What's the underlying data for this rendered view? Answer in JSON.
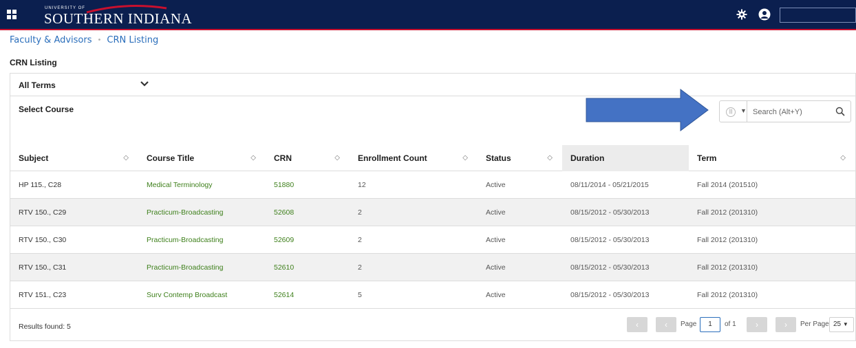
{
  "header": {
    "logo_small": "UNIVERSITY OF",
    "logo_name": "SOUTHERN INDIANA"
  },
  "breadcrumb": {
    "items": [
      "Faculty & Advisors",
      "CRN Listing"
    ],
    "separator": "•"
  },
  "section_title": "CRN Listing",
  "filters": {
    "term_label": "All Terms",
    "select_course_label": "Select Course",
    "search_placeholder": "Search (Alt+Y)"
  },
  "table": {
    "columns": [
      "Subject",
      "Course Title",
      "CRN",
      "Enrollment Count",
      "Status",
      "Duration",
      "Term"
    ],
    "rows": [
      [
        "HP 115., C28",
        "Medical Terminology",
        "51880",
        "12",
        "Active",
        "08/11/2014 - 05/21/2015",
        "Fall 2014 (201510)"
      ],
      [
        "RTV 150., C29",
        "Practicum-Broadcasting",
        "52608",
        "2",
        "Active",
        "08/15/2012 - 05/30/2013",
        "Fall 2012 (201310)"
      ],
      [
        "RTV 150., C30",
        "Practicum-Broadcasting",
        "52609",
        "2",
        "Active",
        "08/15/2012 - 05/30/2013",
        "Fall 2012 (201310)"
      ],
      [
        "RTV 150., C31",
        "Practicum-Broadcasting",
        "52610",
        "2",
        "Active",
        "08/15/2012 - 05/30/2013",
        "Fall 2012 (201310)"
      ],
      [
        "RTV 151., C23",
        "Surv Contemp Broadcast",
        "52614",
        "5",
        "Active",
        "08/15/2012 - 05/30/2013",
        "Fall 2012 (201310)"
      ]
    ]
  },
  "footer": {
    "results": "Results found: 5",
    "page_label": "Page",
    "page_value": "1",
    "of_label": "of 1",
    "per_page_label": "Per Page",
    "per_page_value": "25"
  },
  "colors": {
    "topbar": "#0b1f4f",
    "accent_red": "#c8102e",
    "link_blue": "#2a6ebb",
    "link_green": "#3d7f1a",
    "annotation_arrow": "#4472c4"
  }
}
